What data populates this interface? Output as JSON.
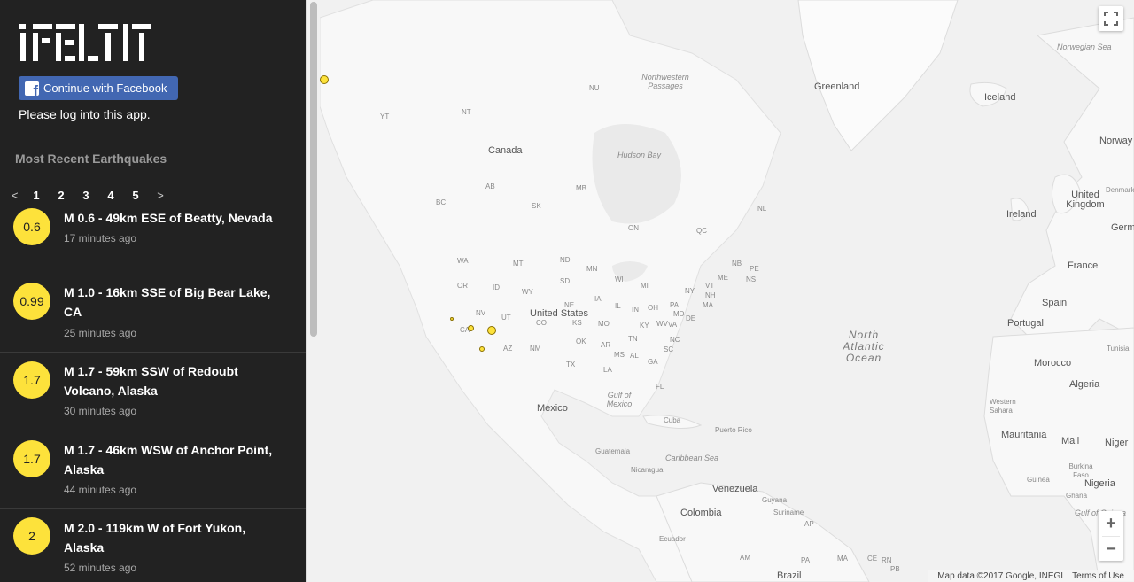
{
  "app": {
    "logo_text": "I FELT IT",
    "facebook_button_label": "Continue with Facebook",
    "login_note": "Please log into this app.",
    "recent_title": "Most Recent Earthquakes"
  },
  "pager": {
    "prev": "<",
    "pages": [
      "1",
      "2",
      "3",
      "4",
      "5"
    ],
    "next": ">"
  },
  "earthquakes": [
    {
      "mag": "0.6",
      "title": "M 0.6 - 49km ESE of Beatty, Nevada",
      "time": "17 minutes ago"
    },
    {
      "mag": "0.99",
      "title": "M 1.0 - 16km SSE of Big Bear Lake, CA",
      "time": "25 minutes ago"
    },
    {
      "mag": "1.7",
      "title": "M 1.7 - 59km SSW of Redoubt Volcano, Alaska",
      "time": "30 minutes ago"
    },
    {
      "mag": "1.7",
      "title": "M 1.7 - 46km WSW of Anchor Point, Alaska",
      "time": "44 minutes ago"
    },
    {
      "mag": "2",
      "title": "M 2.0 - 119km W of Fort Yukon, Alaska",
      "time": "52 minutes ago"
    }
  ],
  "map": {
    "countries": [
      "Canada",
      "United States",
      "Mexico",
      "Greenland",
      "Iceland",
      "Ireland",
      "United Kingdom",
      "Norway",
      "France",
      "Spain",
      "Portugal",
      "Morocco",
      "Algeria",
      "Tunisia",
      "Germany",
      "Denmark",
      "Mali",
      "Niger",
      "Nigeria",
      "Mauritania",
      "Western Sahara",
      "Burkina Faso",
      "Ghana",
      "Guinea",
      "Cuba",
      "Puerto Rico",
      "Guatemala",
      "Nicaragua",
      "Venezuela",
      "Colombia",
      "Guyana",
      "Suriname",
      "Ecuador",
      "Brazil"
    ],
    "regions": [
      "NU",
      "NT",
      "YT",
      "BC",
      "AB",
      "SK",
      "MB",
      "ON",
      "QC",
      "NL",
      "NB",
      "PE",
      "NS",
      "WA",
      "OR",
      "CA",
      "NV",
      "ID",
      "MT",
      "WY",
      "UT",
      "AZ",
      "NM",
      "CO",
      "ND",
      "SD",
      "NE",
      "KS",
      "OK",
      "TX",
      "MN",
      "IA",
      "MO",
      "AR",
      "LA",
      "WI",
      "IL",
      "MI",
      "IN",
      "OH",
      "KY",
      "TN",
      "MS",
      "AL",
      "GA",
      "FL",
      "SC",
      "NC",
      "VA",
      "WV",
      "PA",
      "NY",
      "VT",
      "NH",
      "ME",
      "MA",
      "MD",
      "DE",
      "AP",
      "AM",
      "PA",
      "MA",
      "CE",
      "RN",
      "PB"
    ],
    "waters": [
      "Northwestern Passages",
      "Hudson Bay",
      "Gulf of Mexico",
      "Caribbean Sea",
      "Norwegian Sea",
      "Gulf of Guinea"
    ],
    "ocean": "North Atlantic Ocean",
    "attribution": "Map data ©2017 Google, INEGI",
    "terms": "Terms of Use",
    "zoom_in": "+",
    "zoom_out": "−"
  }
}
